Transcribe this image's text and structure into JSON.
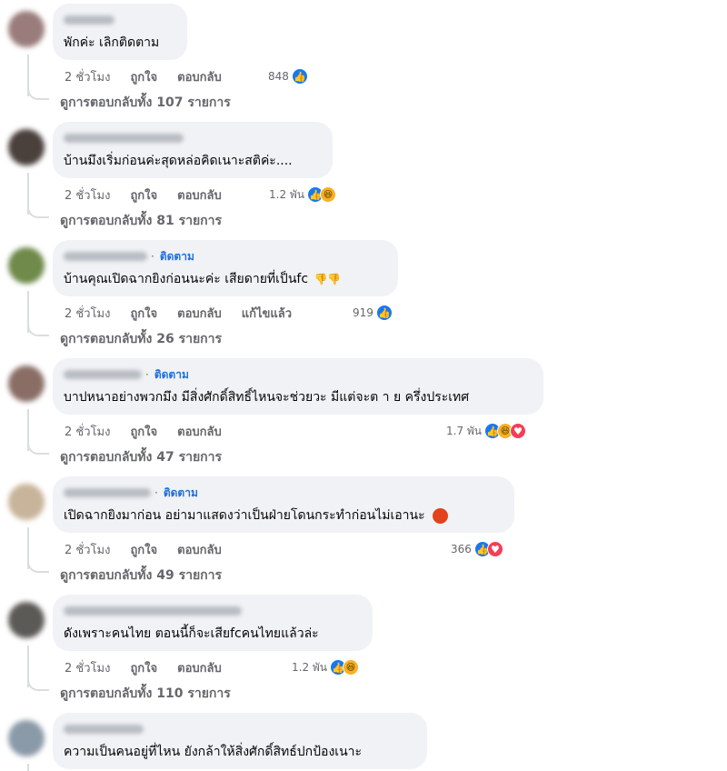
{
  "comments": [
    {
      "text": "พักค่ะ เลิกติดตาม",
      "time": "2 ชั่วโมง",
      "like": "ถูกใจ",
      "reply": "ตอบกลับ",
      "edited": "",
      "follow": "",
      "reaction_count": "848",
      "reactions": [
        "like"
      ],
      "replies_label": "ดูการตอบกลับทั้ง 107 รายการ",
      "avatar_color": "#9a7c7c"
    },
    {
      "text": "บ้านมึงเริ่มก่อนค่ะสุดหล่อคิดเนาะสติค่ะ....",
      "time": "2 ชั่วโมง",
      "like": "ถูกใจ",
      "reply": "ตอบกลับ",
      "edited": "",
      "follow": "",
      "reaction_count": "1.2 พัน",
      "reactions": [
        "like",
        "haha"
      ],
      "replies_label": "ดูการตอบกลับทั้ง 81 รายการ",
      "avatar_color": "#4a403c"
    },
    {
      "text": "บ้านคุณเปิดฉากยิงก่อนนะค่ะ เสียดายที่เป็นfc",
      "time": "2 ชั่วโมง",
      "like": "ถูกใจ",
      "reply": "ตอบกลับ",
      "edited": "แก้ไขแล้ว",
      "follow": "ติดตาม",
      "reaction_count": "919",
      "reactions": [
        "like"
      ],
      "replies_label": "ดูการตอบกลับทั้ง 26 รายการ",
      "avatar_color": "#6f8a4a"
    },
    {
      "text": "บาปหนาอย่างพวกมึง มีสิ่งศักดิ์สิทธิ์ไหนจะช่วยวะ มีแต่จะต า ย ครึ่งประเทศ",
      "time": "2 ชั่วโมง",
      "like": "ถูกใจ",
      "reply": "ตอบกลับ",
      "edited": "",
      "follow": "ติดตาม",
      "reaction_count": "1.7 พัน",
      "reactions": [
        "like",
        "haha",
        "love"
      ],
      "replies_label": "ดูการตอบกลับทั้ง 47 รายการ",
      "avatar_color": "#8a6e66"
    },
    {
      "text": "เปิดฉากยิงมาก่อน อย่ามาแสดงว่าเป็นฝ่ายโดนกระทำก่อนไม่เอานะ",
      "time": "2 ชั่วโมง",
      "like": "ถูกใจ",
      "reply": "ตอบกลับ",
      "edited": "",
      "follow": "ติดตาม",
      "reaction_count": "366",
      "reactions": [
        "like",
        "love"
      ],
      "replies_label": "ดูการตอบกลับทั้ง 49 รายการ",
      "avatar_color": "#c8b49a"
    },
    {
      "text": "ดังเพราะคนไทย ตอนนี้ก็จะเสียfcคนไทยแล้วล่ะ",
      "time": "2 ชั่วโมง",
      "like": "ถูกใจ",
      "reply": "ตอบกลับ",
      "edited": "",
      "follow": "",
      "reaction_count": "1.2 พัน",
      "reactions": [
        "like",
        "haha"
      ],
      "replies_label": "ดูการตอบกลับทั้ง 110 รายการ",
      "avatar_color": "#5c5a56"
    },
    {
      "text": "ความเป็นคนอยู่ที่ไหน ยังกล้าให้สิ่งศักดิ์สิทธ์ปกป้องเนาะ",
      "time": "",
      "like": "",
      "reply": "",
      "edited": "",
      "follow": "",
      "reaction_count": "",
      "reactions": [],
      "replies_label": "",
      "avatar_color": "#8a9aa8"
    }
  ],
  "icons": {
    "like": "thumbs-up-icon",
    "haha": "laughing-face-icon",
    "love": "heart-icon",
    "thumb_down": "thumbs-down-emoji",
    "angry": "angry-face-emoji"
  },
  "colors": {
    "bubble": "#f0f2f5",
    "follow_link": "#216fdb",
    "meta_text": "#65676b",
    "like_blue": "#1877f2",
    "love_red": "#f33e58",
    "haha_yellow": "#f7b125"
  }
}
